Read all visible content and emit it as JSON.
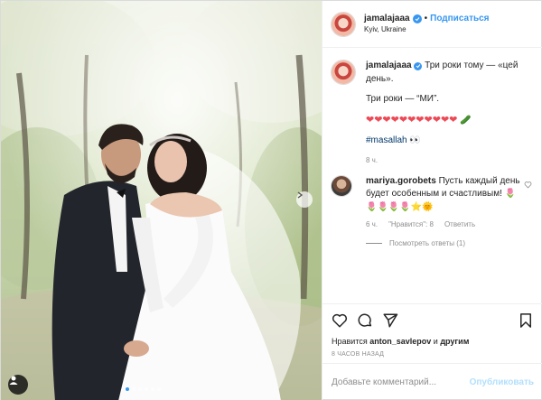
{
  "account": {
    "username": "jamalajaaa",
    "follow_label": "Подписаться",
    "separator": "•",
    "location": "Kyiv, Ukraine"
  },
  "caption": {
    "username": "jamalajaaa",
    "text_line1": "Три роки тому — «цей день».",
    "text_line2": "Три роки — “МИ”.",
    "hearts": "❤❤❤❤❤❤❤❤❤❤❤",
    "hearts_tail": "🥒",
    "hashtag": "#masallah",
    "hashtag_emoji": "👀",
    "time": "8 ч."
  },
  "comment": {
    "username": "mariya.gorobets",
    "text": "Пусть каждый день будет особенным и счастливым! 🌷🌷🌷🌷🌷⭐🌞",
    "time": "6 ч.",
    "likes": "\"Нравится\": 8",
    "reply_label": "Ответить",
    "view_replies": "Посмотреть ответы (1)"
  },
  "likes": {
    "prefix": "Нравится",
    "user": "anton_savlepov",
    "suffix": "и",
    "others": "другим"
  },
  "date": "8 ЧАСОВ НАЗАД",
  "add_comment": {
    "placeholder": "Добавьте комментарий...",
    "publish_label": "Опубликовать"
  },
  "icons": {
    "like": "heart-icon",
    "comment": "comment-icon",
    "share": "share-icon",
    "save": "bookmark-icon",
    "more": "more-icon"
  },
  "colors": {
    "accent": "#3897f0",
    "publish_disabled": "#b2dffc",
    "muted": "#8e8e8e"
  },
  "carousel": {
    "count": 6,
    "active": 1
  }
}
